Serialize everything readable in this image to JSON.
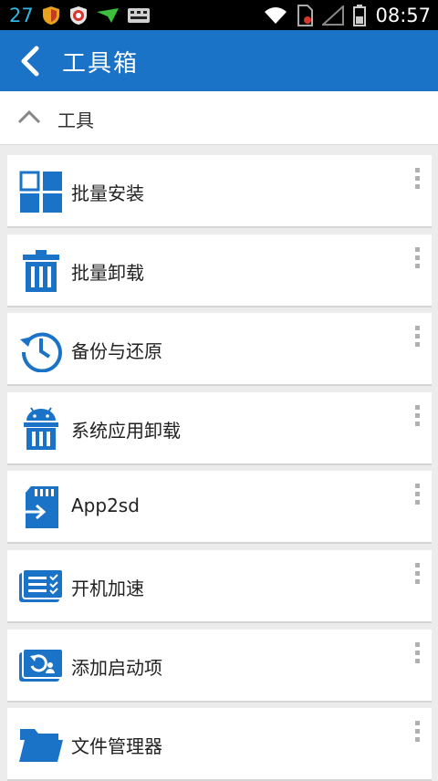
{
  "status_bar": {
    "notification_count": "27",
    "time": "08:57",
    "icons": [
      "shield-icon",
      "antivirus-icon",
      "download-icon",
      "keyboard-icon",
      "wifi-icon",
      "sim-card-icon",
      "signal-icon",
      "battery-icon"
    ]
  },
  "app_bar": {
    "title": "工具箱",
    "back_icon": "back-arrow-icon",
    "color": "#1a73c6"
  },
  "section": {
    "label": "工具",
    "icon": "chevron-up-icon"
  },
  "tools": [
    {
      "label": "批量安装",
      "icon": "grid-icon"
    },
    {
      "label": "批量卸载",
      "icon": "trash-icon"
    },
    {
      "label": "备份与还原",
      "icon": "history-icon"
    },
    {
      "label": "系统应用卸载",
      "icon": "android-trash-icon"
    },
    {
      "label": "App2sd",
      "icon": "sd-card-icon"
    },
    {
      "label": "开机加速",
      "icon": "boot-list-icon"
    },
    {
      "label": "添加启动项",
      "icon": "startup-icon"
    },
    {
      "label": "文件管理器",
      "icon": "folder-icon"
    }
  ]
}
